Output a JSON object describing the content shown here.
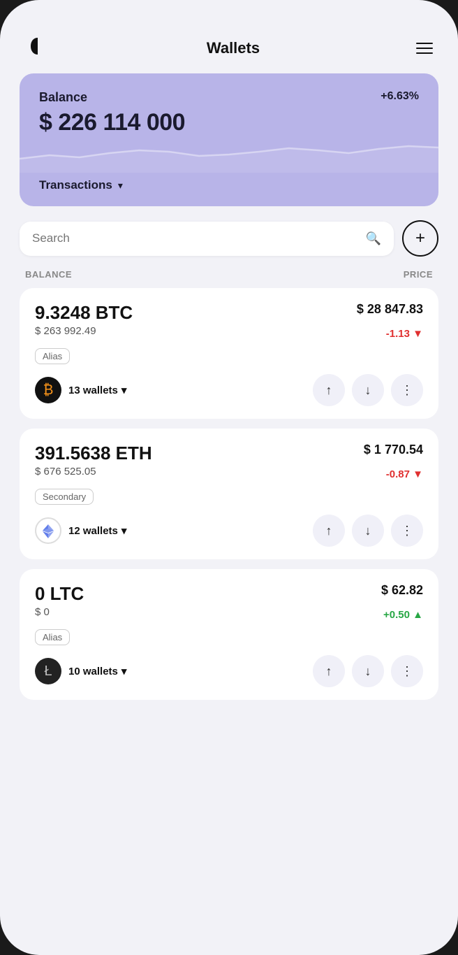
{
  "header": {
    "title": "Wallets",
    "menu_label": "menu"
  },
  "balance_card": {
    "label": "Balance",
    "change": "+6.63%",
    "amount": "$ 226 114 000",
    "transactions_label": "Transactions"
  },
  "search": {
    "placeholder": "Search"
  },
  "add_button_label": "+",
  "columns": {
    "balance": "BALANCE",
    "price": "PRICE"
  },
  "coins": [
    {
      "amount": "9.3248 BTC",
      "fiat": "$ 263 992.49",
      "tag": "Alias",
      "price": "$ 28 847.83",
      "change": "-1.13",
      "change_type": "neg",
      "wallets": "13 wallets",
      "logo": "₿",
      "logo_color": "#111"
    },
    {
      "amount": "391.5638 ETH",
      "fiat": "$ 676 525.05",
      "tag": "Secondary",
      "price": "$ 1 770.54",
      "change": "-0.87",
      "change_type": "neg",
      "wallets": "12 wallets",
      "logo": "⟠",
      "logo_color": "#627eea"
    },
    {
      "amount": "0 LTC",
      "fiat": "$ 0",
      "tag": "Alias",
      "price": "$ 62.82",
      "change": "+0.50",
      "change_type": "pos",
      "wallets": "10 wallets",
      "logo": "Ł",
      "logo_color": "#bfbbbb"
    }
  ]
}
